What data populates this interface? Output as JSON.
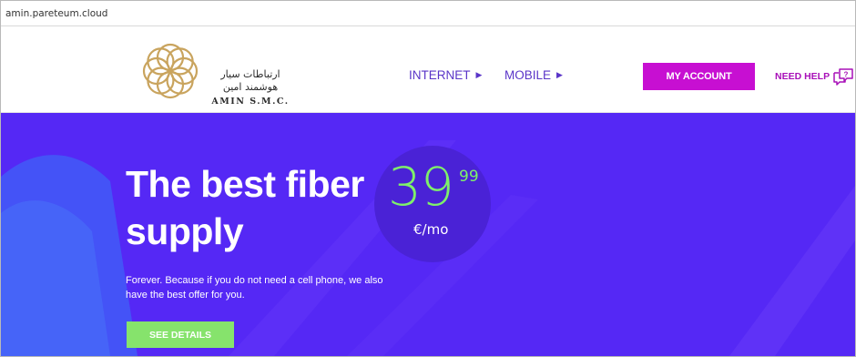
{
  "browser": {
    "url": "amin.pareteum.cloud"
  },
  "header": {
    "logo": {
      "persian_name": "ارتباطات سیار هوشمند امین",
      "english_name": "AMIN S.M.C."
    },
    "nav": [
      {
        "label": "INTERNET",
        "icon": "caret-right-icon"
      },
      {
        "label": "MOBILE",
        "icon": "caret-right-icon"
      }
    ],
    "account_label": "MY ACCOUNT",
    "help_label": "NEED HELP",
    "help_icon": "speech-bubble-question-icon"
  },
  "hero": {
    "title_line1": "The best fiber",
    "title_line2": "supply",
    "price_main": "39",
    "price_cents": "99",
    "price_unit": "€/mo",
    "description": "Forever. Because if you do not need a cell phone, we also have the best offer for you.",
    "cta_label": "SEE DETAILS"
  },
  "colors": {
    "hero_bg": "#5528f5",
    "accent_magenta": "#c70fd2",
    "price_green": "#7ff06a",
    "cta_green": "#86e36c",
    "logo_gold": "#c9a45e"
  }
}
